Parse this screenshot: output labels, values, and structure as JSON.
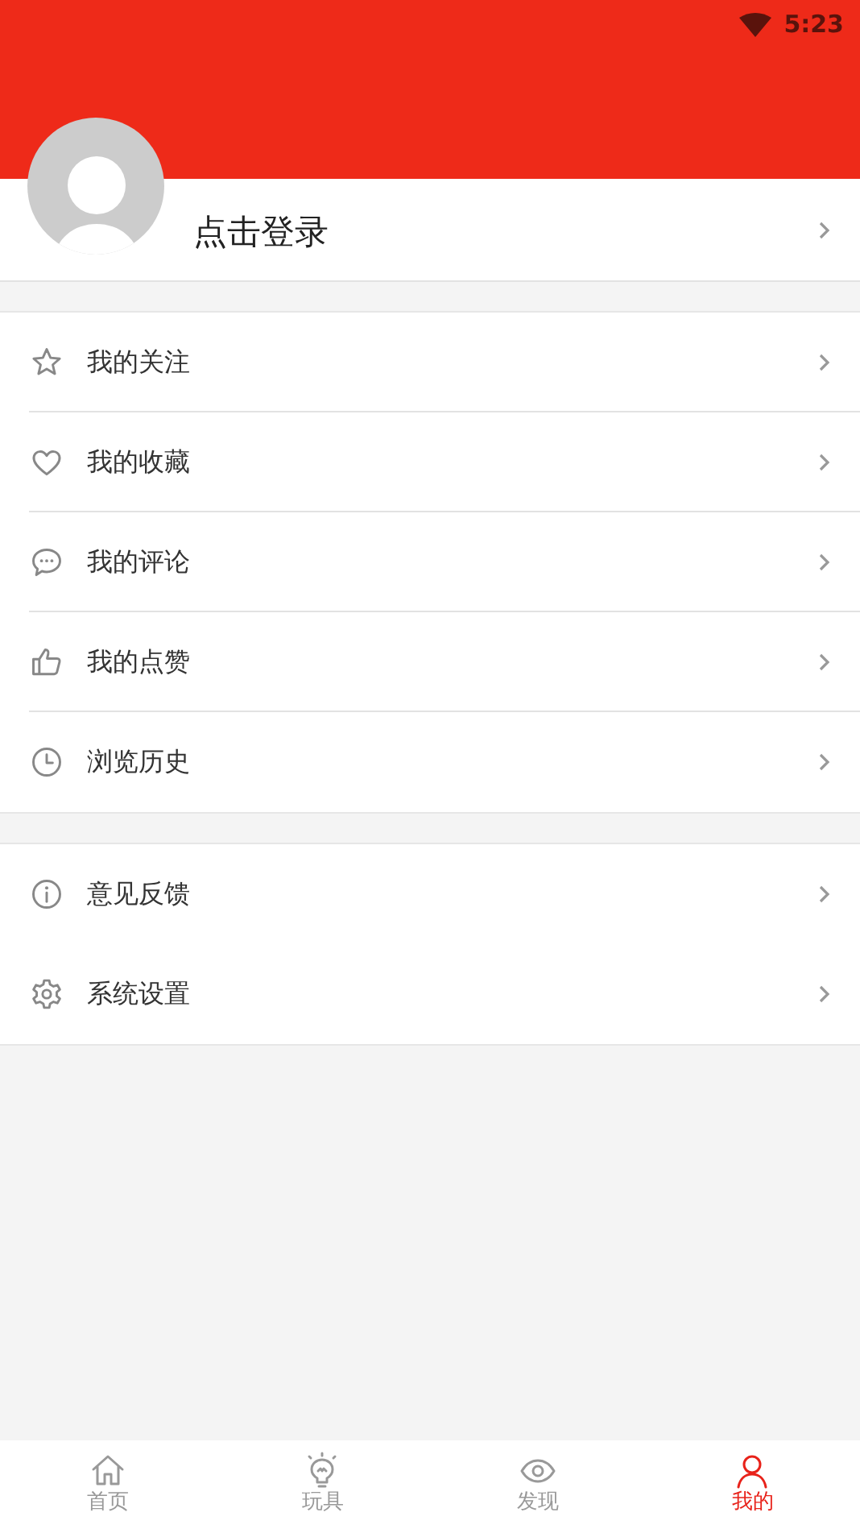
{
  "status_bar": {
    "time": "5:23"
  },
  "profile": {
    "login_label": "点击登录"
  },
  "menu_groups": [
    {
      "items": [
        {
          "label": "我的关注"
        },
        {
          "label": "我的收藏"
        },
        {
          "label": "我的评论"
        },
        {
          "label": "我的点赞"
        },
        {
          "label": "浏览历史"
        }
      ]
    },
    {
      "items": [
        {
          "label": "意见反馈"
        },
        {
          "label": "系统设置"
        }
      ]
    }
  ],
  "tab_bar": [
    {
      "label": "首页",
      "selected": false
    },
    {
      "label": "玩具",
      "selected": false
    },
    {
      "label": "发现",
      "selected": false
    },
    {
      "label": "我的",
      "selected": true
    }
  ]
}
